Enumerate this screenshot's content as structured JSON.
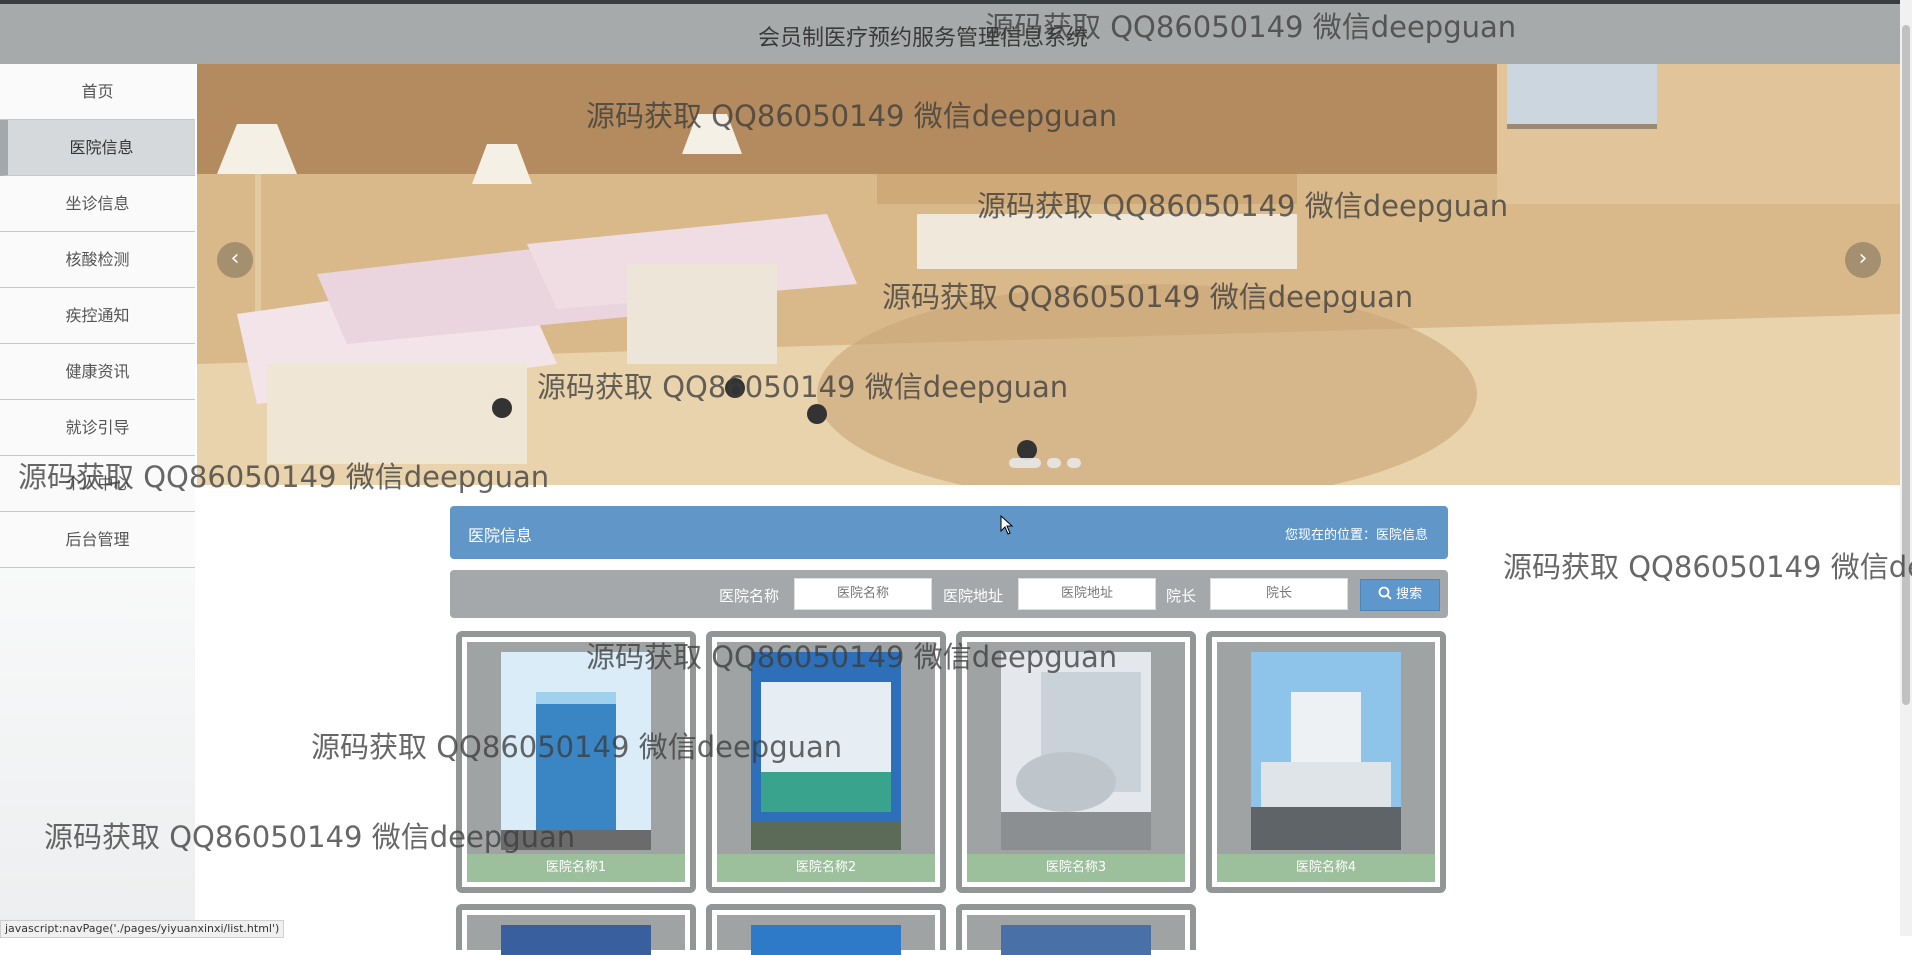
{
  "header": {
    "title": "会员制医疗预约服务管理信息系统"
  },
  "sidebar": {
    "items": [
      {
        "label": "首页"
      },
      {
        "label": "医院信息"
      },
      {
        "label": "坐诊信息"
      },
      {
        "label": "核酸检测"
      },
      {
        "label": "疾控通知"
      },
      {
        "label": "健康资讯"
      },
      {
        "label": "就诊引导"
      },
      {
        "label": "个人中心"
      },
      {
        "label": "后台管理"
      }
    ],
    "active_index": 1
  },
  "banner": {
    "prev_icon": "‹",
    "next_icon": "›",
    "slide_count": 3,
    "active_slide": 1
  },
  "panel": {
    "title": "医院信息",
    "location": "您现在的位置：医院信息"
  },
  "search": {
    "name_label": "医院名称",
    "name_placeholder": "医院名称",
    "address_label": "医院地址",
    "address_placeholder": "医院地址",
    "dean_label": "院长",
    "dean_placeholder": "院长",
    "button_label": "搜索",
    "button_icon": "search-icon"
  },
  "hospitals": [
    {
      "name": "医院名称1"
    },
    {
      "name": "医院名称2"
    },
    {
      "name": "医院名称3"
    },
    {
      "name": "医院名称4"
    }
  ],
  "watermark": "源码获取 QQ86050149 微信deepguan",
  "watermark_cut": "源码获取 QQ86050149 微信de",
  "status_bar": "javascript:navPage('./pages/yiyuanxinxi/list.html')",
  "colors": {
    "header_bg": "#a7aaab",
    "panel_blue": "#6197c8",
    "card_label": "#9cbf9c"
  }
}
